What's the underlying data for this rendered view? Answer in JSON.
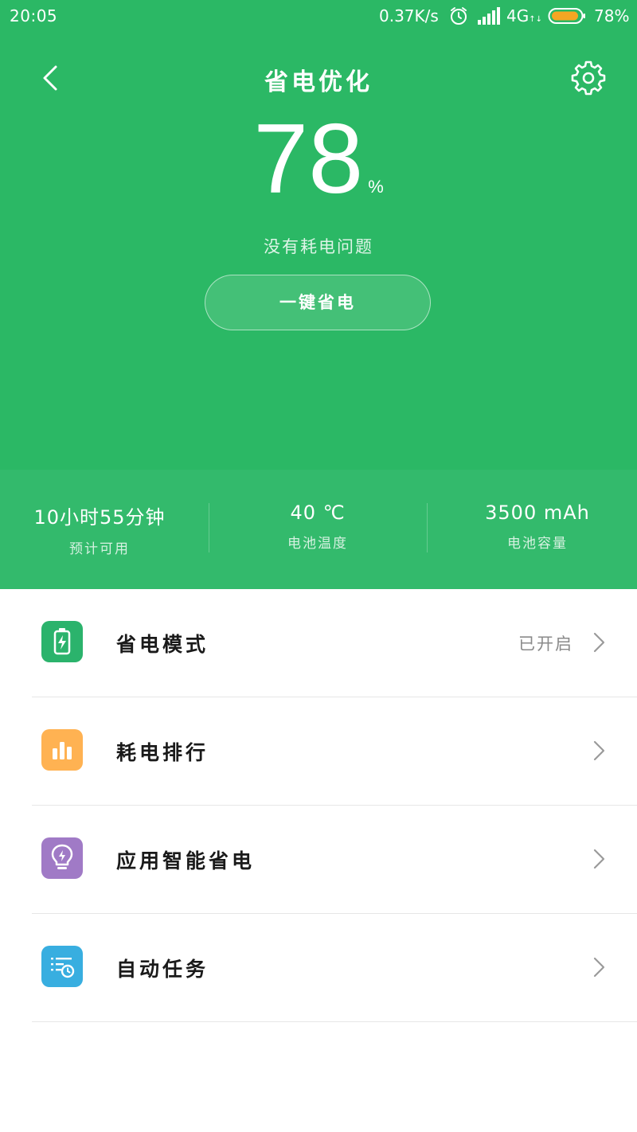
{
  "status_bar": {
    "time": "20:05",
    "network_speed": "0.37K/s",
    "network_type": "4G",
    "network_arrows": "↑↓",
    "battery_percent": "78%"
  },
  "header": {
    "title": "省电优化"
  },
  "battery": {
    "level": "78",
    "unit": "%",
    "status": "没有耗电问题"
  },
  "action": {
    "one_key_label": "一键省电"
  },
  "stats": [
    {
      "value": "10小时55分钟",
      "label": "预计可用"
    },
    {
      "value": "40 ℃",
      "label": "电池温度"
    },
    {
      "value": "3500 mAh",
      "label": "电池容量"
    }
  ],
  "menu": [
    {
      "label": "省电模式",
      "status": "已开启",
      "icon": "battery-charge-icon",
      "color": "#2bb36c"
    },
    {
      "label": "耗电排行",
      "status": "",
      "icon": "bar-chart-icon",
      "color": "#ffb252"
    },
    {
      "label": "应用智能省电",
      "status": "",
      "icon": "lightbulb-icon",
      "color": "#a07ac6"
    },
    {
      "label": "自动任务",
      "status": "",
      "icon": "scheduled-list-icon",
      "color": "#38aee0"
    }
  ],
  "colors": {
    "accent_green": "#2bb865",
    "stats_band": "#33ba6c"
  }
}
